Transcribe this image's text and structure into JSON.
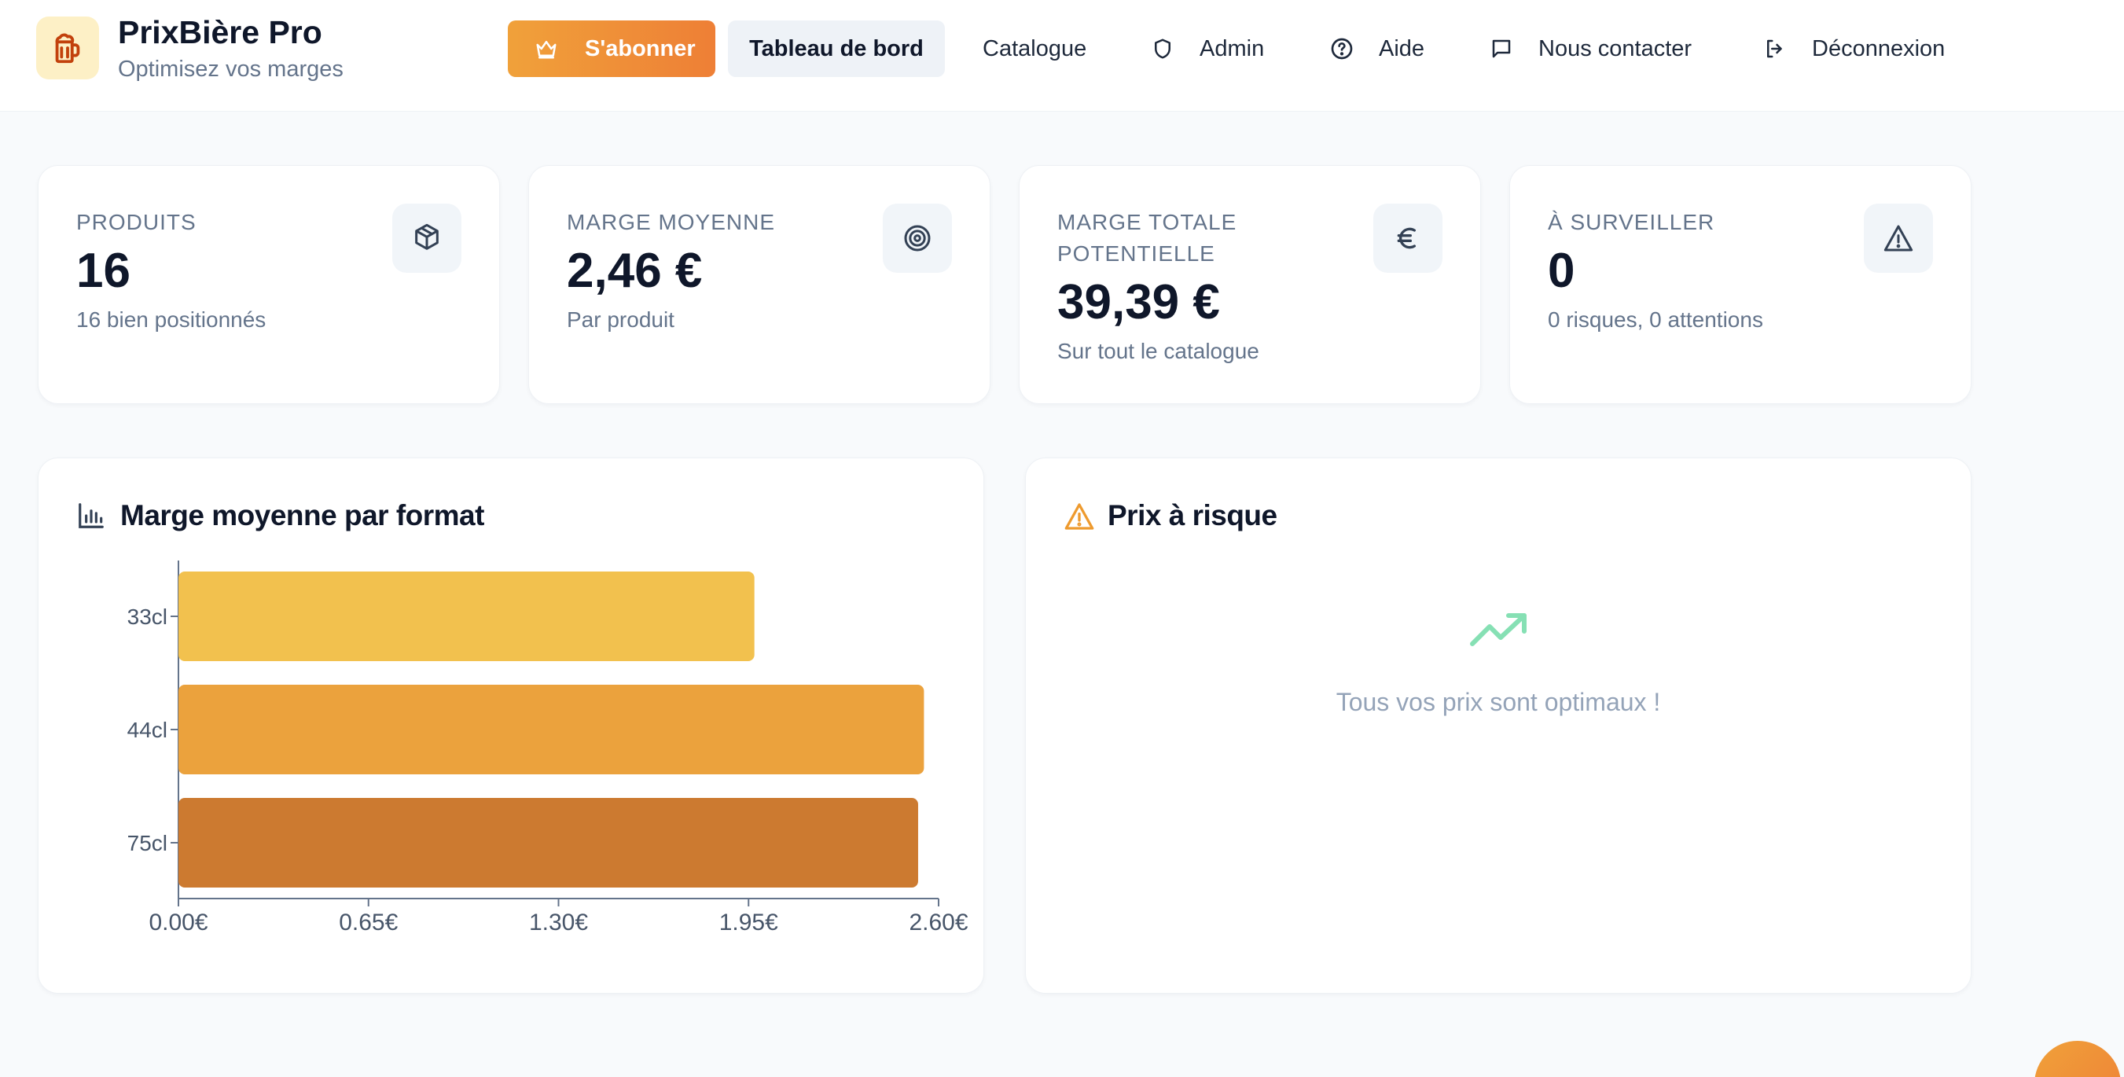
{
  "brand": {
    "title": "PrixBière Pro",
    "subtitle": "Optimisez vos marges"
  },
  "nav": {
    "subscribe": "S'abonner",
    "dashboard": "Tableau de bord",
    "catalogue": "Catalogue",
    "admin": "Admin",
    "help": "Aide",
    "contact": "Nous contacter",
    "logout": "Déconnexion"
  },
  "stats": [
    {
      "label": "PRODUITS",
      "value": "16",
      "sub": "16 bien positionnés",
      "icon": "package-icon"
    },
    {
      "label": "MARGE MOYENNE",
      "value": "2,46 €",
      "sub": "Par produit",
      "icon": "target-icon"
    },
    {
      "label": "MARGE TOTALE POTENTIELLE",
      "value": "39,39 €",
      "sub": "Sur tout le catalogue",
      "icon": "euro-icon"
    },
    {
      "label": "À SURVEILLER",
      "value": "0",
      "sub": "0 risques, 0 attentions",
      "icon": "alert-triangle-icon"
    }
  ],
  "format_panel": {
    "title": "Marge moyenne par format",
    "icon": "bar-chart-icon"
  },
  "risk_panel": {
    "title": "Prix à risque",
    "message": "Tous vos prix sont optimaux !",
    "icon": "alert-triangle-icon"
  },
  "chart_data": {
    "type": "bar",
    "orientation": "horizontal",
    "categories": [
      "33cl",
      "44cl",
      "75cl"
    ],
    "values": [
      1.97,
      2.55,
      2.53
    ],
    "colors": [
      "#f2c14e",
      "#eba23d",
      "#cc7a30"
    ],
    "xticks": [
      "0.00€",
      "0.65€",
      "1.30€",
      "1.95€",
      "2.60€"
    ],
    "xlim": [
      0,
      2.6
    ],
    "title": "Marge moyenne par format",
    "grid": false,
    "legend": "none"
  },
  "colors": {
    "accent": "#ee8a36",
    "trend": "#86e0b4"
  }
}
